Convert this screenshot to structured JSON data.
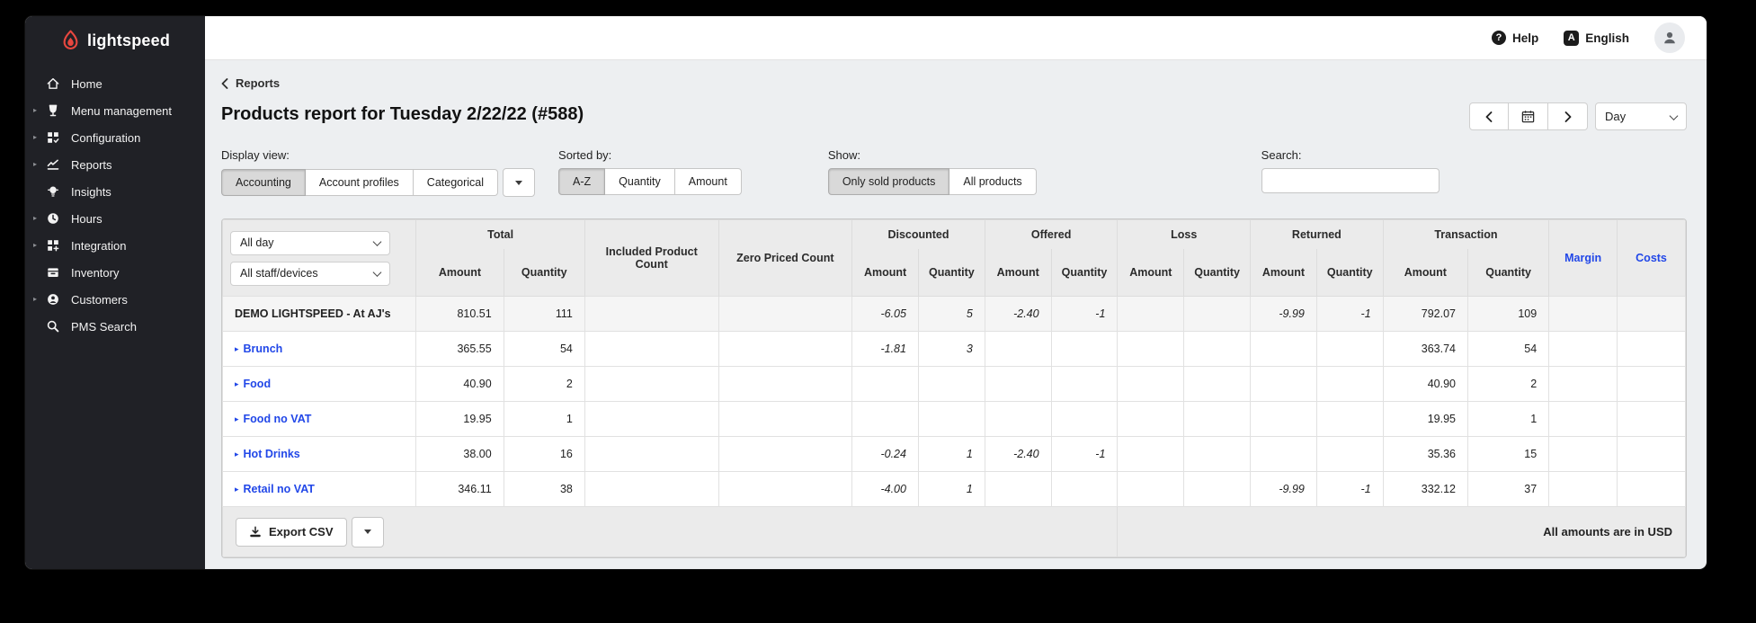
{
  "brand": {
    "name": "lightspeed"
  },
  "sidebar": {
    "items": [
      {
        "label": "Home",
        "icon": "home-icon",
        "expandable": false
      },
      {
        "label": "Menu management",
        "icon": "menu-management-icon",
        "expandable": true
      },
      {
        "label": "Configuration",
        "icon": "configuration-icon",
        "expandable": true
      },
      {
        "label": "Reports",
        "icon": "reports-icon",
        "expandable": true
      },
      {
        "label": "Insights",
        "icon": "insights-icon",
        "expandable": false
      },
      {
        "label": "Hours",
        "icon": "hours-icon",
        "expandable": true
      },
      {
        "label": "Integration",
        "icon": "integration-icon",
        "expandable": true
      },
      {
        "label": "Inventory",
        "icon": "inventory-icon",
        "expandable": false
      },
      {
        "label": "Customers",
        "icon": "customers-icon",
        "expandable": true
      },
      {
        "label": "PMS Search",
        "icon": "pms-search-icon",
        "expandable": false
      }
    ]
  },
  "topbar": {
    "help_label": "Help",
    "language_badge": "A",
    "language_label": "English"
  },
  "breadcrumb": {
    "label": "Reports"
  },
  "page": {
    "title": "Products report for Tuesday 2/22/22 (#588)"
  },
  "date_nav": {
    "prev": "❮",
    "next": "❯",
    "period_value": "Day"
  },
  "filters": {
    "display_view": {
      "label": "Display view:",
      "options": [
        "Accounting",
        "Account profiles",
        "Categorical"
      ],
      "selected": "Accounting"
    },
    "sorted_by": {
      "label": "Sorted by:",
      "options": [
        "A-Z",
        "Quantity",
        "Amount"
      ],
      "selected": "A-Z"
    },
    "show": {
      "label": "Show:",
      "options": [
        "Only sold products",
        "All products"
      ],
      "selected": "Only sold products"
    },
    "search": {
      "label": "Search:",
      "value": ""
    }
  },
  "table": {
    "time_filter": "All day",
    "staff_filter": "All staff/devices",
    "groups": {
      "total": "Total",
      "included_product_count": "Included Product Count",
      "zero_priced_count": "Zero Priced Count",
      "discounted": "Discounted",
      "offered": "Offered",
      "loss": "Loss",
      "returned": "Returned",
      "transaction": "Transaction",
      "margin": "Margin",
      "costs": "Costs"
    },
    "sub": {
      "amount": "Amount",
      "quantity": "Quantity"
    },
    "rows": [
      {
        "name": "DEMO LIGHTSPEED - At AJ's",
        "is_summary": true,
        "cells": [
          "810.51",
          "111",
          "",
          "",
          "-6.05",
          "5",
          "-2.40",
          "-1",
          "",
          "",
          "-9.99",
          "-1",
          "792.07",
          "109",
          "",
          ""
        ]
      },
      {
        "name": "Brunch",
        "is_summary": false,
        "cells": [
          "365.55",
          "54",
          "",
          "",
          "-1.81",
          "3",
          "",
          "",
          "",
          "",
          "",
          "",
          "363.74",
          "54",
          "",
          ""
        ]
      },
      {
        "name": "Food",
        "is_summary": false,
        "cells": [
          "40.90",
          "2",
          "",
          "",
          "",
          "",
          "",
          "",
          "",
          "",
          "",
          "",
          "40.90",
          "2",
          "",
          ""
        ]
      },
      {
        "name": "Food no VAT",
        "is_summary": false,
        "cells": [
          "19.95",
          "1",
          "",
          "",
          "",
          "",
          "",
          "",
          "",
          "",
          "",
          "",
          "19.95",
          "1",
          "",
          ""
        ]
      },
      {
        "name": "Hot Drinks",
        "is_summary": false,
        "cells": [
          "38.00",
          "16",
          "",
          "",
          "-0.24",
          "1",
          "-2.40",
          "-1",
          "",
          "",
          "",
          "",
          "35.36",
          "15",
          "",
          ""
        ]
      },
      {
        "name": "Retail no VAT",
        "is_summary": false,
        "cells": [
          "346.11",
          "38",
          "",
          "",
          "-4.00",
          "1",
          "",
          "",
          "",
          "",
          "-9.99",
          "-1",
          "332.12",
          "37",
          "",
          ""
        ]
      }
    ],
    "footer": {
      "export_label": "Export CSV",
      "note": "All amounts are in USD"
    }
  },
  "colors": {
    "accent_blue": "#2147e8",
    "brand_red": "#e8473f",
    "active_button_bg": "#d9d9d9",
    "sidebar_bg": "#202126"
  }
}
